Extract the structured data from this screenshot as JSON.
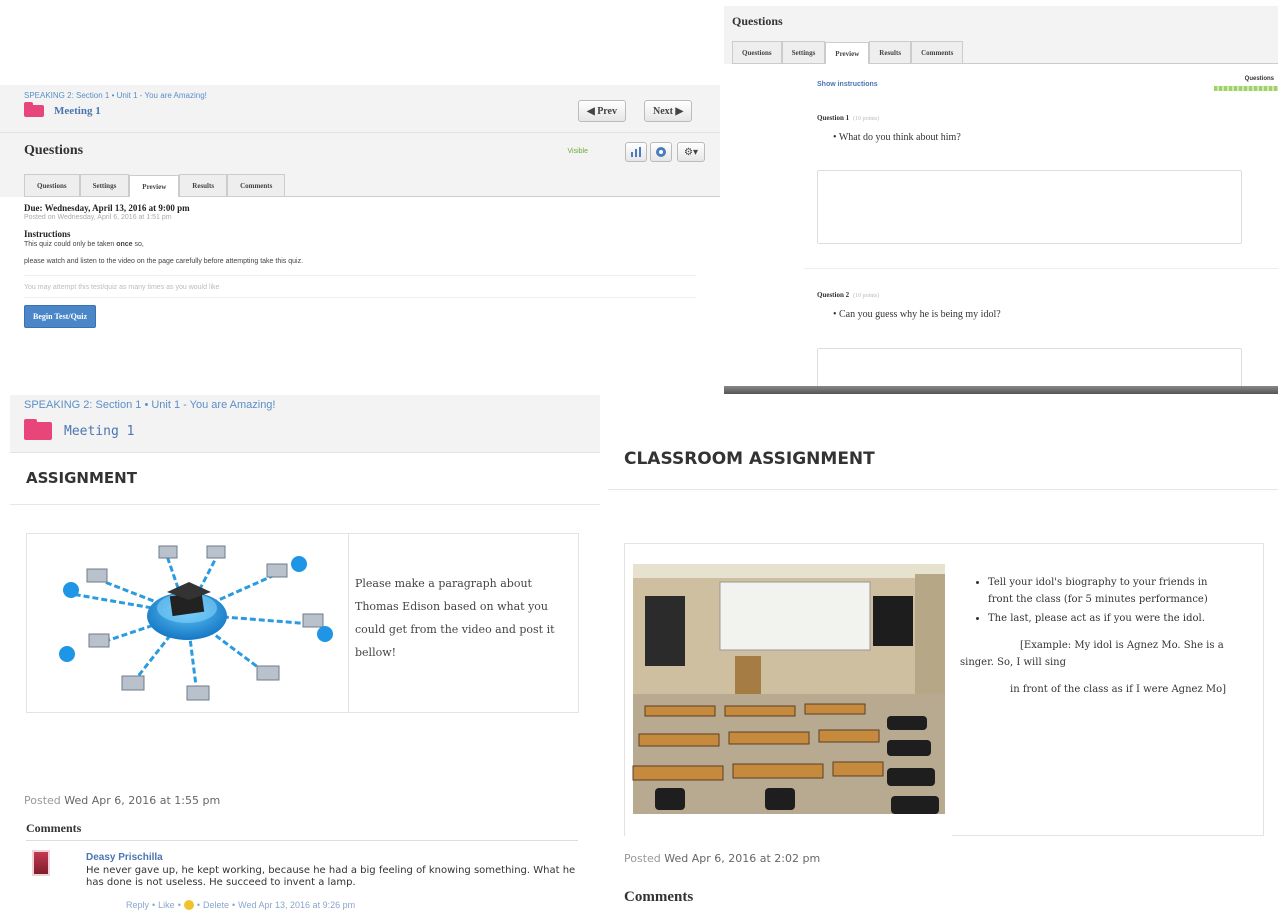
{
  "quiz_panel": {
    "breadcrumb": "SPEAKING 2: Section 1 • Unit 1 - You are Amazing!",
    "meeting": "Meeting 1",
    "prev_label": "◀ Prev",
    "next_label": "Next ▶",
    "title": "Questions",
    "visible_label": "Visible",
    "tabs": [
      "Questions",
      "Settings",
      "Preview",
      "Results",
      "Comments"
    ],
    "active_tab": "Preview",
    "due": "Due: Wednesday, April 13, 2016 at 9:00 pm",
    "posted": "Posted on Wednesday, April 6, 2016 at 1:51 pm",
    "instructions_label": "Instructions",
    "instructions_pre": "This quiz could only be taken ",
    "instructions_bold": "once",
    "instructions_post": " so,",
    "instructions_2": "please watch and listen to the video on the page carefully before attempting take this quiz.",
    "attempt_note": "You may attempt this test/quiz as many times as you would like",
    "begin_label": "Begin Test/Quiz"
  },
  "preview_panel": {
    "title": "Questions",
    "tabs": [
      "Questions",
      "Settings",
      "Preview",
      "Results",
      "Comments"
    ],
    "active_tab": "Preview",
    "show_instructions": "Show instructions",
    "progress_label": "Questions",
    "questions": [
      {
        "label": "Question 1",
        "points": "(10 points)",
        "text": "What do you think about him?"
      },
      {
        "label": "Question 2",
        "points": "(10 points)",
        "text": "Can you guess why he is being my idol?"
      }
    ]
  },
  "assignment_panel": {
    "breadcrumb": "SPEAKING 2: Section 1 • Unit 1 - You are Amazing!",
    "meeting": "Meeting 1",
    "title": "ASSIGNMENT",
    "body": "Please make a paragraph about Thomas Edison based on what you could get from the video and post it bellow!",
    "posted_prefix": "Posted ",
    "posted_date": "Wed Apr 6, 2016 at 1:55 pm",
    "comments_label": "Comments",
    "comment": {
      "author": "Deasy Prischilla",
      "text": "He never gave up, he kept working, because he had a big feeling of knowing something. What he has done is not useless. He succeed to invent a lamp.",
      "reply": "Reply",
      "like": "Like",
      "delete": "Delete",
      "time": "Wed Apr 13, 2016 at 9:26 pm"
    }
  },
  "classroom_panel": {
    "title": "CLASSROOM ASSIGNMENT",
    "bullets": [
      "Tell your idol's biography to your friends in front the class (for 5 minutes performance)",
      "The last, please act as if you were the idol."
    ],
    "example_1": "[Example: My idol is Agnez Mo. She is a singer. So, I will sing",
    "example_2": "in front of the class as if I were Agnez Mo]",
    "posted_prefix": "Posted ",
    "posted_date": "Wed Apr 6, 2016 at 2:02 pm",
    "comments_label": "Comments"
  }
}
